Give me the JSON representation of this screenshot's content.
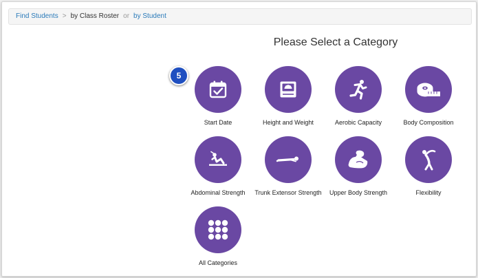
{
  "breadcrumb": {
    "find_students": "Find Students",
    "sep": ">",
    "by_class_roster": "by Class Roster",
    "or": "or",
    "by_student": "by Student"
  },
  "heading": "Please Select a Category",
  "step_badge": "5",
  "categories": [
    {
      "label": "Start Date",
      "icon": "calendar-check-icon"
    },
    {
      "label": "Height and Weight",
      "icon": "scale-icon"
    },
    {
      "label": "Aerobic Capacity",
      "icon": "running-person-icon"
    },
    {
      "label": "Body Composition",
      "icon": "tape-measure-icon"
    },
    {
      "label": "Abdominal Strength",
      "icon": "curl-up-icon"
    },
    {
      "label": "Trunk Extensor Strength",
      "icon": "trunk-lift-icon"
    },
    {
      "label": "Upper Body Strength",
      "icon": "flexed-arm-icon"
    },
    {
      "label": "Flexibility",
      "icon": "stretching-person-icon"
    },
    {
      "label": "All Categories",
      "icon": "grid-dots-icon"
    }
  ],
  "colors": {
    "tile_purple": "#6a48a3",
    "link_blue": "#2a7ab9",
    "badge_blue": "#1f4fc0"
  }
}
